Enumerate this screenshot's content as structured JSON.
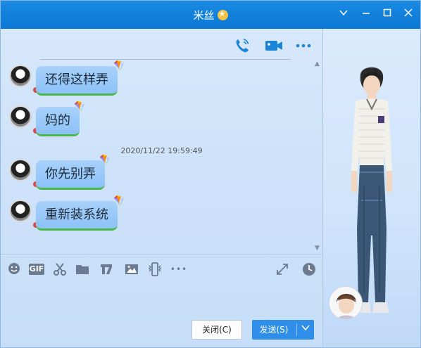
{
  "window": {
    "title": "米丝",
    "title_badge_icon": "star-badge-icon",
    "controls": [
      "chevron-down-icon",
      "minimize-icon",
      "maximize-icon",
      "close-icon"
    ]
  },
  "chat_toolbar": {
    "icons": [
      "phone-icon",
      "video-icon",
      "more-icon"
    ],
    "accent": "#1a84d8"
  },
  "messages": [
    {
      "text": "还得这样弄"
    },
    {
      "text": "妈的"
    },
    {
      "text": "你先别弄"
    },
    {
      "text": "重新装系统"
    }
  ],
  "timestamp": "2020/11/22 19:59:49",
  "input_toolbar": {
    "icons": [
      "emoji-icon",
      "gif-icon",
      "scissors-icon",
      "folder-icon",
      "music-note-icon",
      "image-icon",
      "phone-shake-icon",
      "more-dots-icon",
      "expand-icon",
      "clock-icon"
    ],
    "gif_label": "GIF",
    "more_label": "•••"
  },
  "buttons": {
    "close_label": "关闭(C)",
    "send_label": "发送(S)"
  },
  "colors": {
    "titlebar": "#0b78d4",
    "bubble": "#97c8f8",
    "bubble_underline": "#49b848",
    "send_button": "#2f8ee8"
  }
}
